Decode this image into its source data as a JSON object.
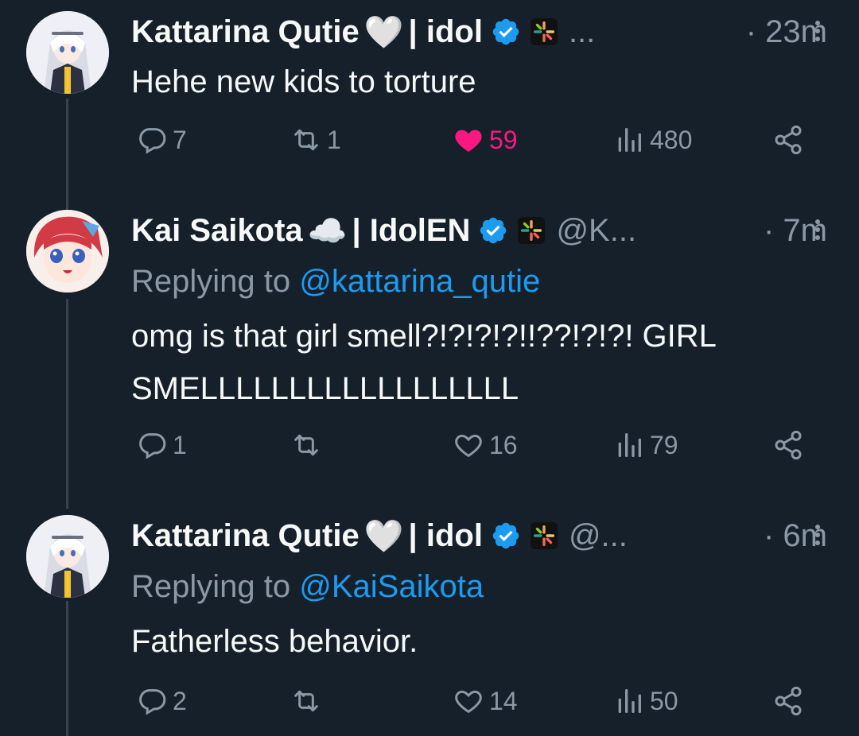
{
  "tweets": [
    {
      "name": "Kattarina Qutie",
      "emoji": "🤍",
      "suffix": "| idol",
      "handle": "...",
      "time": "· 23m",
      "replying_prefix": "",
      "replying_to": "",
      "text": "Hehe new kids to torture",
      "replies": "7",
      "retweets": "1",
      "likes": "59",
      "liked": true,
      "views": "480"
    },
    {
      "name": "Kai Saikota",
      "emoji": "☁️",
      "suffix": "| IdolEN",
      "handle": "@K...",
      "time": "· 7m",
      "replying_prefix": "Replying to ",
      "replying_to": "@kattarina_qutie",
      "text": "omg is that girl smell?!?!?!?!!??!?!?! GIRL SMELLLLLLLLLLLLLLLLLL",
      "replies": "1",
      "retweets": "",
      "likes": "16",
      "liked": false,
      "views": "79"
    },
    {
      "name": "Kattarina Qutie",
      "emoji": "🤍",
      "suffix": "| idol",
      "handle": "@...",
      "time": "· 6m",
      "replying_prefix": "Replying to ",
      "replying_to": "@KaiSaikota",
      "text": "Fatherless behavior.",
      "replies": "2",
      "retweets": "",
      "likes": "14",
      "liked": false,
      "views": "50"
    }
  ],
  "icons": {
    "reply": "reply-icon",
    "retweet": "retweet-icon",
    "like": "heart-icon",
    "views": "views-icon",
    "share": "share-icon",
    "verified": "verified-badge-icon",
    "more": "more-options-icon"
  },
  "colors": {
    "background": "#15202b",
    "accent": "#1d9bf0",
    "like": "#f91880",
    "muted": "#8b98a5",
    "text": "#f7f9f9"
  }
}
